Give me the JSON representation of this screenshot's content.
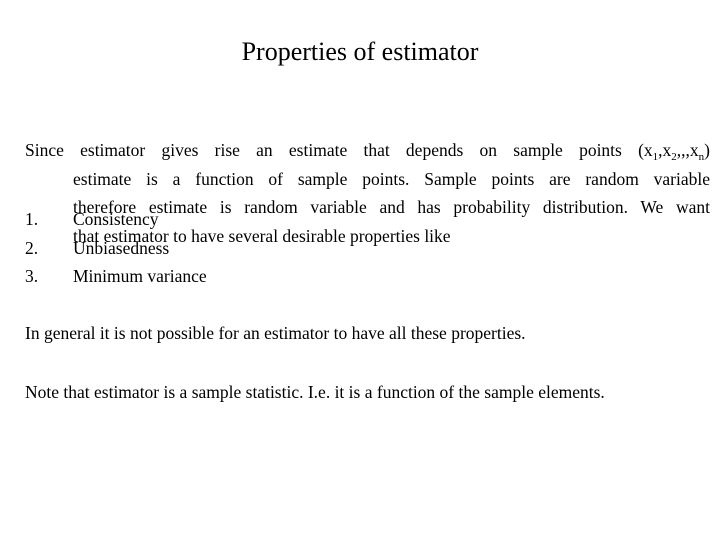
{
  "slide": {
    "title": "Properties of estimator",
    "intro": {
      "line1_text": "Since estimator gives rise an estimate that depends on sample points (x",
      "sub1": "1",
      "sep1": ",x",
      "sub2": "2",
      "sep2": ",,,x",
      "subn": "n",
      "close": ")",
      "line2": "estimate is a function of sample points. Sample points are random variable",
      "line3": "therefore estimate is random variable and has probability distribution. We want",
      "line4": "that estimator to have several desirable properties like"
    },
    "properties": [
      {
        "number": "1.",
        "label": "Consistency"
      },
      {
        "number": "2.",
        "label": "Unbiasedness"
      },
      {
        "number": "3.",
        "label": "Minimum variance"
      }
    ],
    "paragraph2": "In general it is not possible for an estimator to have all these properties.",
    "paragraph3": "Note that estimator is a sample statistic. I.e. it is a function of the sample elements."
  }
}
